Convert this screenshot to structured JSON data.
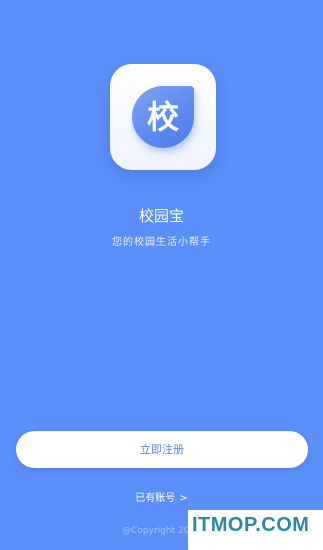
{
  "app": {
    "logo_char": "校",
    "name": "校园宝",
    "slogan": "您的校园生活小帮手"
  },
  "actions": {
    "register_label": "立即注册",
    "login_label": "已有账号",
    "login_arrow": ">"
  },
  "footer": {
    "copyright": "@Copyright 2018"
  },
  "watermark": {
    "text": "ITMOP.COM"
  },
  "colors": {
    "background": "#5b8ff9",
    "button_text": "#5a87ee",
    "watermark_text": "#2a8a9e"
  }
}
